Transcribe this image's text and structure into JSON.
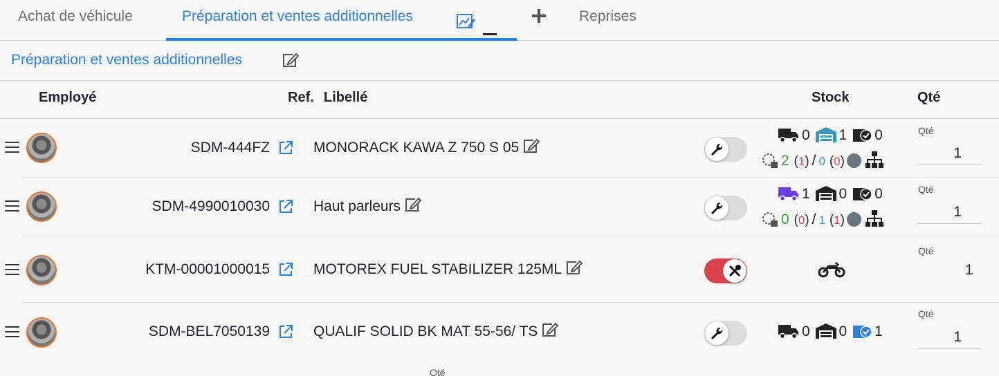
{
  "tabs": [
    {
      "label": "Achat de véhicule"
    },
    {
      "label": "Préparation et ventes additionnelles"
    },
    {
      "label": "Reprises"
    }
  ],
  "section": {
    "title": "Préparation et ventes additionnelles"
  },
  "table": {
    "headers": {
      "employee": "Employé",
      "ref": "Ref.",
      "label": "Libellé",
      "stock": "Stock",
      "qty": "Qté"
    }
  },
  "rows": [
    {
      "ref": "SDM-444FZ",
      "label": "MONORACK KAWA Z 750 S 05",
      "service": false,
      "stock": {
        "truck": "0",
        "depot": "1",
        "boxes": "0",
        "a": "2",
        "a_paren": "1",
        "b": "0",
        "b_paren": "0"
      },
      "qty_label": "Qté",
      "qty": "1"
    },
    {
      "ref": "SDM-4990010030",
      "label": "Haut parleurs",
      "service": false,
      "stock": {
        "truck": "1",
        "depot": "0",
        "boxes": "0",
        "a": "0",
        "a_paren": "0",
        "b": "1",
        "b_paren": "1"
      },
      "qty_label": "Qté",
      "qty": "1"
    },
    {
      "ref": "KTM-00001000015",
      "label": "MOTOREX FUEL STABILIZER 125ML",
      "service": true,
      "qty_label": "Qté",
      "qty": "1"
    },
    {
      "ref": "SDM-BEL7050139",
      "label": "QUALIF SOLID BK MAT 55-56/ TS",
      "service": false,
      "stock": {
        "truck": "0",
        "depot": "0",
        "boxes": "1"
      },
      "qty_label": "Qté",
      "qty": "1"
    }
  ],
  "footer_qty_label": "Qté",
  "colors": {
    "accent": "#2f7fde",
    "toggle_on": "#d9434f",
    "avatar_ring": "#e07a35"
  }
}
